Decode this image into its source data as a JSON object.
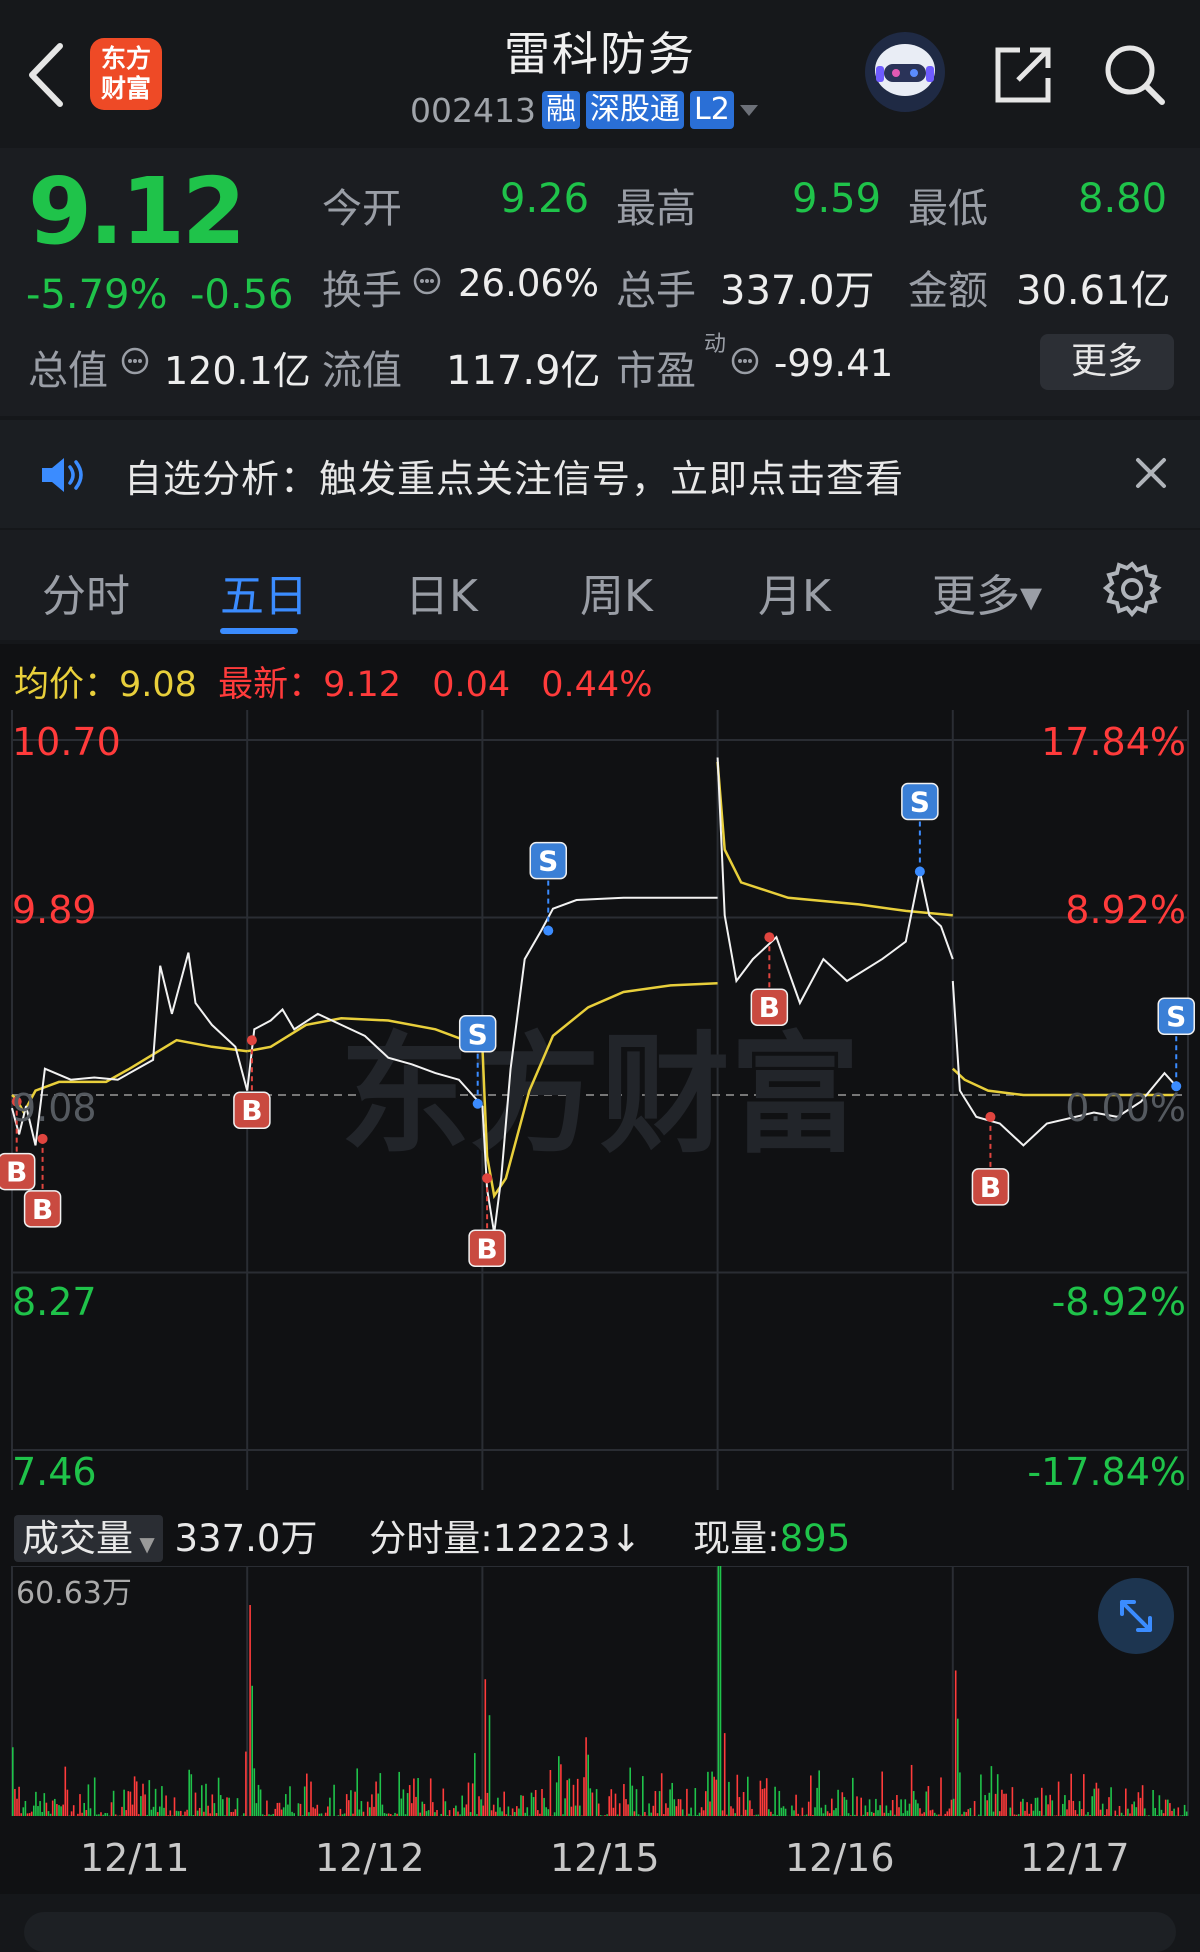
{
  "header": {
    "back_icon": "chevron-left-icon",
    "logo_text_1": "东方",
    "logo_text_2": "财富",
    "title": "雷科防务",
    "code": "002413",
    "tags": [
      "融",
      "深股通",
      "L2"
    ],
    "ai_icon": "robot-assistant-icon",
    "share_icon": "share-icon",
    "search_icon": "search-icon"
  },
  "quote": {
    "price": "9.12",
    "change_pct": "-5.79%",
    "change_amt": "-0.56",
    "open_label": "今开",
    "open": "9.26",
    "high_label": "最高",
    "high": "9.59",
    "low_label": "最低",
    "low": "8.80",
    "turnover_label": "换手",
    "turnover": "26.06%",
    "volume_label": "总手",
    "volume": "337.0万",
    "amount_label": "金额",
    "amount": "30.61亿",
    "mktcap_label": "总值",
    "mktcap": "120.1亿",
    "float_label": "流值",
    "float": "117.9亿",
    "pe_label": "市盈",
    "pe_sup": "动",
    "pe": "-99.41",
    "more_label": "更多",
    "info_icon": "info-circle-icon"
  },
  "notice": {
    "icon": "speaker-icon",
    "text": "自选分析：触发重点关注信号，立即点击查看",
    "close_icon": "close-icon"
  },
  "tabs": {
    "items": [
      "分时",
      "五日",
      "日K",
      "周K",
      "月K",
      "更多▾"
    ],
    "active": "五日",
    "settings_icon": "gear-icon"
  },
  "colors": {
    "up": "#ff3b3b",
    "down": "#1fc34a",
    "avg": "#e8cf3b",
    "accent": "#3b8cff",
    "bg": "#101113"
  },
  "chart": {
    "avg_label": "均价：",
    "avg_value": "9.08",
    "latest_label": "最新：",
    "latest_value": "9.12",
    "latest_chg": "0.04",
    "latest_pct": "0.44%",
    "y_left": [
      "10.70",
      "9.89",
      "9.08",
      "8.27",
      "7.46"
    ],
    "y_right": [
      "17.84%",
      "8.92%",
      "0.00%",
      "-8.92%",
      "-17.84%"
    ],
    "watermark": "东方财富",
    "volume_select": "成交量",
    "volume_total": "337.0万",
    "tick_vol_label": "分时量:",
    "tick_vol_value": "12223↓",
    "cur_vol_label": "现量:",
    "cur_vol_value": "895",
    "vol_max": "60.63万",
    "expand_icon": "expand-arrows-icon",
    "dates": [
      "12/11",
      "12/12",
      "12/15",
      "12/16",
      "12/17"
    ]
  },
  "chart_data": {
    "type": "line",
    "x": [
      "12/11",
      "12/12",
      "12/15",
      "12/16",
      "12/17"
    ],
    "ylim": [
      7.46,
      10.7
    ],
    "series": [
      {
        "name": "均价",
        "points": [
          [
            0.0,
            9.08
          ],
          [
            0.02,
            9.06
          ],
          [
            0.05,
            9.0
          ],
          [
            0.1,
            9.1
          ],
          [
            0.2,
            9.14
          ],
          [
            0.4,
            9.14
          ],
          [
            0.5,
            9.2
          ],
          [
            0.7,
            9.33
          ],
          [
            0.85,
            9.3
          ],
          [
            1.0,
            9.28
          ],
          [
            1.0,
            9.28
          ],
          [
            1.1,
            9.3
          ],
          [
            1.25,
            9.4
          ],
          [
            1.4,
            9.43
          ],
          [
            1.6,
            9.42
          ],
          [
            1.8,
            9.38
          ],
          [
            2.0,
            9.3
          ],
          [
            2.0,
            9.3
          ],
          [
            2.02,
            8.8
          ],
          [
            2.05,
            8.62
          ],
          [
            2.1,
            8.7
          ],
          [
            2.2,
            9.1
          ],
          [
            2.3,
            9.35
          ],
          [
            2.45,
            9.48
          ],
          [
            2.6,
            9.55
          ],
          [
            2.8,
            9.58
          ],
          [
            3.0,
            9.59
          ],
          [
            3.0,
            10.6
          ],
          [
            3.03,
            10.2
          ],
          [
            3.1,
            10.05
          ],
          [
            3.3,
            9.98
          ],
          [
            3.6,
            9.95
          ],
          [
            3.8,
            9.92
          ],
          [
            4.0,
            9.9
          ],
          [
            4.0,
            9.2
          ],
          [
            4.05,
            9.15
          ],
          [
            4.15,
            9.1
          ],
          [
            4.3,
            9.08
          ],
          [
            4.5,
            9.08
          ],
          [
            4.8,
            9.08
          ],
          [
            4.95,
            9.08
          ]
        ]
      },
      {
        "name": "最新",
        "points": [
          [
            0.0,
            9.02
          ],
          [
            0.03,
            8.9
          ],
          [
            0.06,
            9.03
          ],
          [
            0.1,
            8.85
          ],
          [
            0.14,
            9.2
          ],
          [
            0.25,
            9.15
          ],
          [
            0.35,
            9.16
          ],
          [
            0.45,
            9.15
          ],
          [
            0.6,
            9.24
          ],
          [
            0.63,
            9.67
          ],
          [
            0.68,
            9.45
          ],
          [
            0.75,
            9.73
          ],
          [
            0.78,
            9.5
          ],
          [
            0.85,
            9.4
          ],
          [
            0.95,
            9.3
          ],
          [
            1.0,
            9.1
          ],
          [
            1.0,
            9.1
          ],
          [
            1.03,
            9.38
          ],
          [
            1.1,
            9.42
          ],
          [
            1.15,
            9.47
          ],
          [
            1.2,
            9.38
          ],
          [
            1.3,
            9.45
          ],
          [
            1.4,
            9.4
          ],
          [
            1.5,
            9.35
          ],
          [
            1.6,
            9.25
          ],
          [
            1.7,
            9.22
          ],
          [
            1.8,
            9.18
          ],
          [
            1.9,
            9.15
          ],
          [
            2.0,
            9.03
          ],
          [
            2.0,
            9.03
          ],
          [
            2.02,
            8.65
          ],
          [
            2.05,
            8.45
          ],
          [
            2.08,
            8.7
          ],
          [
            2.12,
            9.2
          ],
          [
            2.18,
            9.7
          ],
          [
            2.25,
            9.83
          ],
          [
            2.3,
            9.93
          ],
          [
            2.4,
            9.97
          ],
          [
            2.6,
            9.98
          ],
          [
            2.8,
            9.98
          ],
          [
            3.0,
            9.98
          ],
          [
            3.0,
            10.62
          ],
          [
            3.03,
            9.9
          ],
          [
            3.08,
            9.6
          ],
          [
            3.15,
            9.7
          ],
          [
            3.25,
            9.8
          ],
          [
            3.35,
            9.5
          ],
          [
            3.45,
            9.7
          ],
          [
            3.55,
            9.6
          ],
          [
            3.7,
            9.7
          ],
          [
            3.8,
            9.78
          ],
          [
            3.86,
            10.1
          ],
          [
            3.9,
            9.9
          ],
          [
            3.95,
            9.85
          ],
          [
            4.0,
            9.7
          ],
          [
            4.0,
            9.6
          ],
          [
            4.03,
            9.1
          ],
          [
            4.1,
            8.98
          ],
          [
            4.2,
            8.95
          ],
          [
            4.3,
            8.85
          ],
          [
            4.4,
            8.95
          ],
          [
            4.6,
            9.0
          ],
          [
            4.7,
            8.98
          ],
          [
            4.8,
            9.05
          ],
          [
            4.9,
            9.18
          ],
          [
            4.95,
            9.12
          ]
        ]
      }
    ],
    "markers": [
      {
        "type": "B",
        "day": 0.02,
        "price": 9.05
      },
      {
        "type": "B",
        "day": 0.13,
        "price": 8.88
      },
      {
        "type": "B",
        "day": 1.02,
        "price": 9.33
      },
      {
        "type": "S",
        "day": 1.98,
        "price": 9.04
      },
      {
        "type": "B",
        "day": 2.02,
        "price": 8.7
      },
      {
        "type": "S",
        "day": 2.28,
        "price": 9.83
      },
      {
        "type": "B",
        "day": 3.22,
        "price": 9.8
      },
      {
        "type": "S",
        "day": 3.86,
        "price": 10.1
      },
      {
        "type": "B",
        "day": 4.16,
        "price": 8.98
      },
      {
        "type": "S",
        "day": 4.95,
        "price": 9.12
      }
    ],
    "volume_max": "60.63万"
  }
}
